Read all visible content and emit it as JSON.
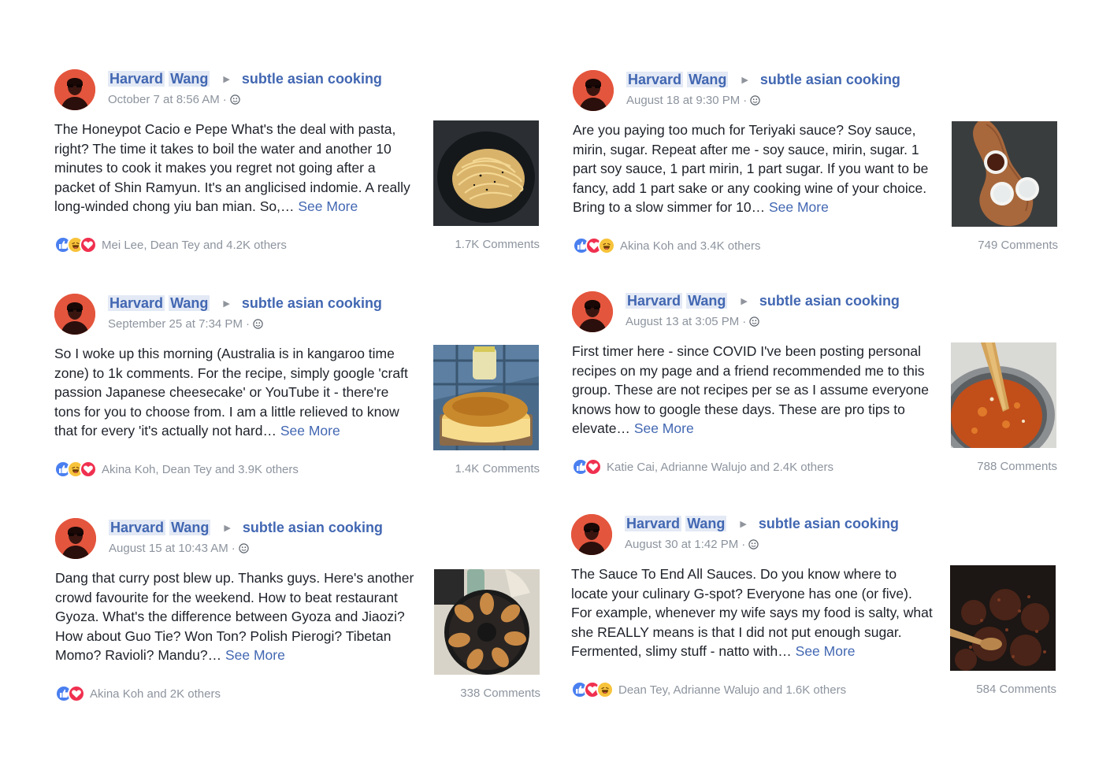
{
  "posts": [
    {
      "author_first": "Harvard",
      "author_last": "Wang",
      "group": "subtle asian cooking",
      "time": "October 7 at 8:56 AM",
      "text": "The Honeypot Cacio e Pepe What's the deal with pasta, right? The time it takes to boil the water and another 10 minutes to cook it makes you regret not going after a packet of Shin Ramyun. It's an anglicised indomie. A really long-winded chong yiu ban mian. So,…",
      "see_more": "See More",
      "reactions": [
        "like",
        "haha",
        "love"
      ],
      "reactors": "Mei Lee, Dean Tey and 4.2K others",
      "comments": "1.7K Comments",
      "photo": "pasta"
    },
    {
      "author_first": "Harvard",
      "author_last": "Wang",
      "group": "subtle asian cooking",
      "time": "August 18 at 9:30 PM",
      "text": "Are you paying too much for Teriyaki sauce? Soy sauce, mirin, sugar. Repeat after me - soy sauce, mirin, sugar. 1 part soy sauce, 1 part mirin, 1 part sugar. If you want to be fancy, add 1 part sake or any cooking wine of your choice. Bring to a slow simmer for 10…",
      "see_more": "See More",
      "reactions": [
        "like",
        "love",
        "haha"
      ],
      "reactors": "Akina Koh and 3.4K others",
      "comments": "749 Comments",
      "photo": "sauces"
    },
    {
      "author_first": "Harvard",
      "author_last": "Wang",
      "group": "subtle asian cooking",
      "time": "September 25 at 7:34 PM",
      "text": "So I woke up this morning (Australia is in kangaroo time zone) to 1k comments. For the recipe, simply google 'craft passion Japanese cheesecake' or YouTube it - there're tons for you to choose from. I am a little relieved to know that for every 'it's actually not hard…",
      "see_more": "See More",
      "reactions": [
        "like",
        "haha",
        "love"
      ],
      "reactors": "Akina Koh, Dean Tey and 3.9K others",
      "comments": "1.4K Comments",
      "photo": "cheesecake"
    },
    {
      "author_first": "Harvard",
      "author_last": "Wang",
      "group": "subtle asian cooking",
      "time": "August 13 at 3:05 PM",
      "text": "First timer here - since COVID I've been posting personal recipes on my page and a friend recommended me to this group. These are not recipes per se as I assume everyone knows how to google these days. These are pro tips to elevate…",
      "see_more": "See More",
      "reactions": [
        "like",
        "love"
      ],
      "reactors": "Katie Cai, Adrianne Walujo and 2.4K others",
      "comments": "788 Comments",
      "photo": "curry"
    },
    {
      "author_first": "Harvard",
      "author_last": "Wang",
      "group": "subtle asian cooking",
      "time": "August 15 at 10:43 AM",
      "text": "Dang that curry post blew up. Thanks guys. Here's another crowd favourite for the weekend. How to beat restaurant Gyoza. What's the difference between Gyoza and Jiaozi? How about Guo Tie? Won Ton? Polish Pierogi? Tibetan Momo? Ravioli? Mandu?…",
      "see_more": "See More",
      "reactions": [
        "like",
        "love"
      ],
      "reactors": "Akina Koh and 2K others",
      "comments": "338 Comments",
      "photo": "gyoza"
    },
    {
      "author_first": "Harvard",
      "author_last": "Wang",
      "group": "subtle asian cooking",
      "time": "August 30 at 1:42 PM",
      "text": "The Sauce To End All Sauces. Do you know where to locate your culinary G-spot? Everyone has one (or five). For example, whenever my wife says my food is salty, what she REALLY means is that I did not put enough sugar. Fermented, slimy stuff - natto with…",
      "see_more": "See More",
      "reactions": [
        "like",
        "love",
        "haha"
      ],
      "reactors": "Dean Tey, Adrianne Walujo and 1.6K others",
      "comments": "584 Comments",
      "photo": "natto"
    }
  ],
  "colors": {
    "link": "#4267b2",
    "meta": "#8d949e",
    "avatar_bg": "#e4553d",
    "like": "#4a7ff0",
    "love": "#f0304f",
    "haha": "#f7c33a"
  }
}
